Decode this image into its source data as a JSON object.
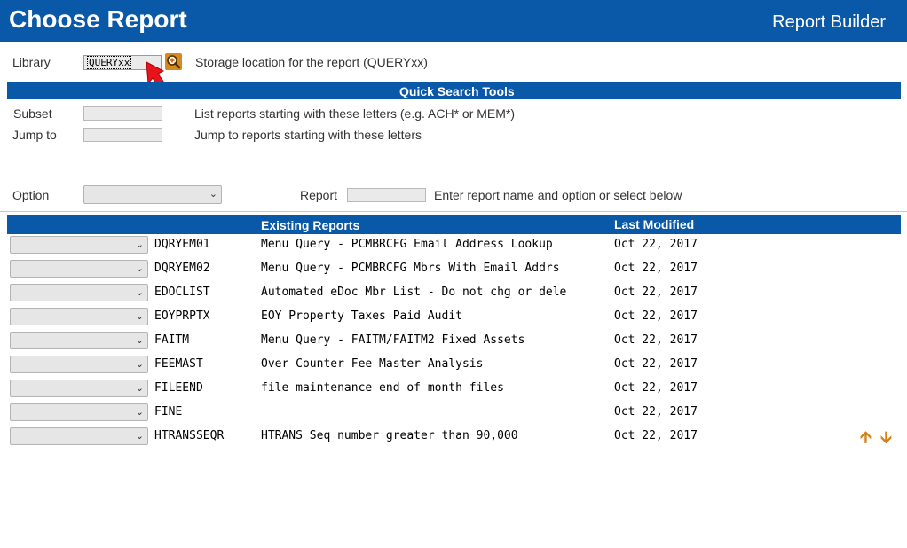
{
  "header": {
    "title": "Choose Report",
    "app_name": "Report Builder"
  },
  "library": {
    "label": "Library",
    "value": "QUERYxx",
    "description": "Storage location for the report (QUERYxx)"
  },
  "quick_search": {
    "title": "Quick Search Tools",
    "subset_label": "Subset",
    "subset_value": "",
    "subset_description": "List reports starting with these letters (e.g. ACH* or MEM*)",
    "jump_label": "Jump to",
    "jump_value": "",
    "jump_description": "Jump to reports starting with these letters"
  },
  "option_row": {
    "option_label": "Option",
    "option_value": "",
    "report_label": "Report",
    "report_value": "",
    "report_description": "Enter report name and option or select below"
  },
  "table": {
    "col_reports": "Existing Reports",
    "col_modified": "Last Modified",
    "rows": [
      {
        "name": "DQRYEM01",
        "description": "Menu Query - PCMBRCFG Email Address Lookup",
        "modified": "Oct 22, 2017"
      },
      {
        "name": "DQRYEM02",
        "description": "Menu Query - PCMBRCFG Mbrs With Email Addrs",
        "modified": "Oct 22, 2017"
      },
      {
        "name": "EDOCLIST",
        "description": "Automated eDoc Mbr List - Do not chg or dele",
        "modified": "Oct 22, 2017"
      },
      {
        "name": "EOYPRPTX",
        "description": "EOY Property Taxes Paid Audit",
        "modified": "Oct 22, 2017"
      },
      {
        "name": "FAITM",
        "description": "Menu Query - FAITM/FAITM2 Fixed Assets",
        "modified": "Oct 22, 2017"
      },
      {
        "name": "FEEMAST",
        "description": "Over Counter Fee Master Analysis",
        "modified": "Oct 22, 2017"
      },
      {
        "name": "FILEEND",
        "description": "file maintenance end of month files",
        "modified": "Oct 22, 2017"
      },
      {
        "name": "FINE",
        "description": "",
        "modified": "Oct 22, 2017"
      },
      {
        "name": "HTRANSSEQR",
        "description": "HTRANS Seq number greater than 90,000",
        "modified": "Oct 22, 2017"
      }
    ]
  },
  "icons": {
    "lookup": "magnifier-plus-icon",
    "pointer": "red-arrow-pointer-icon",
    "scroll_up": "arrow-up-icon",
    "scroll_down": "arrow-down-icon"
  },
  "colors": {
    "brand_blue": "#0a58a8",
    "accent_orange": "#d57f15",
    "pointer_red": "#e8141c"
  }
}
